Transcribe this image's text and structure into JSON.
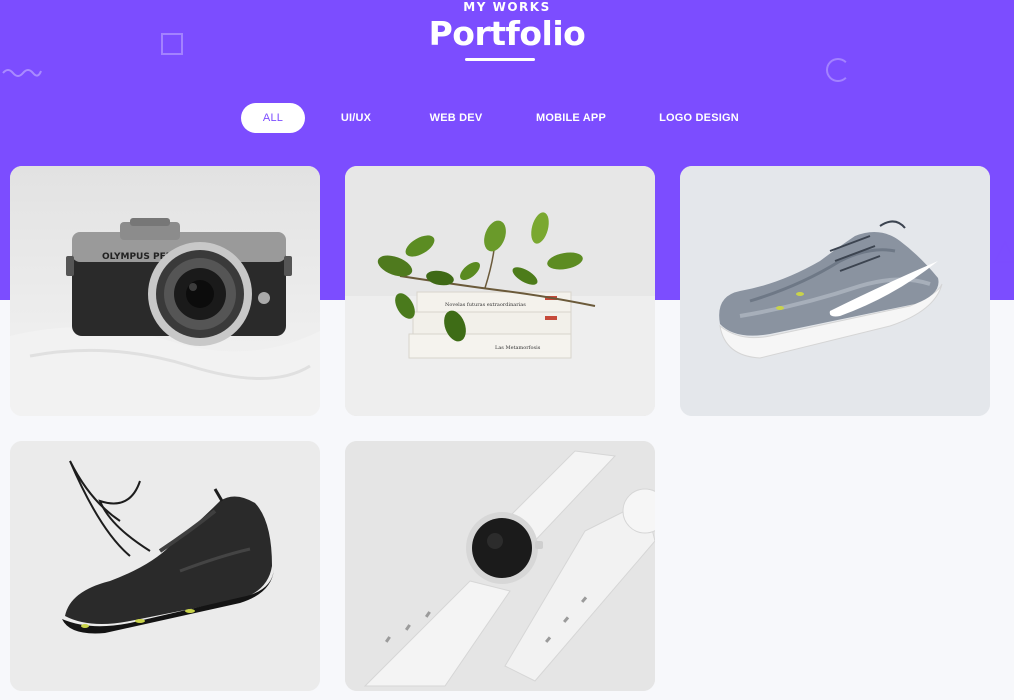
{
  "section": {
    "subtitle": "MY WORKS",
    "title": "Portfolio"
  },
  "filters": [
    {
      "label": "ALL",
      "active": true
    },
    {
      "label": "UI/UX",
      "active": false
    },
    {
      "label": "WEB DEV",
      "active": false
    },
    {
      "label": "MOBILE APP",
      "active": false
    },
    {
      "label": "LOGO DESIGN",
      "active": false
    }
  ],
  "portfolio_items": [
    {
      "image": "camera-photo",
      "camera_brand": "OLYMPUS PEN"
    },
    {
      "image": "books-with-plant-photo",
      "book_titles": [
        "Novelas futuras extraordinarias",
        "Las Metamorfosis"
      ]
    },
    {
      "image": "grey-sneaker-photo"
    },
    {
      "image": "black-sneaker-photo"
    },
    {
      "image": "white-smartwatch-photo"
    }
  ],
  "colors": {
    "accent": "#7c4dff",
    "background": "#f7f8fb",
    "white": "#ffffff"
  }
}
